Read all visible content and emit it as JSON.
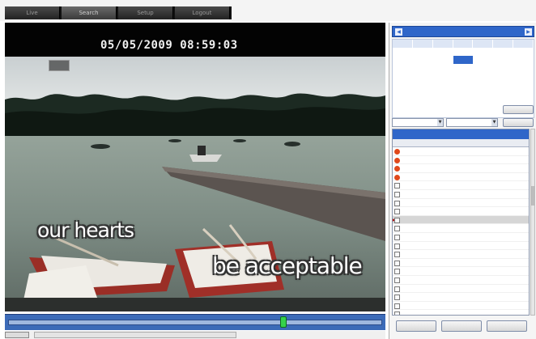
{
  "tabs": [
    "Live",
    "Search",
    "Setup",
    "Logout"
  ],
  "active_tab": 1,
  "video": {
    "timestamp": "05/05/2009 08:59:03",
    "subtitle_line1": "our hearts",
    "subtitle_line2": "be acceptable"
  },
  "timeline": {
    "position": 0.74
  },
  "status": {
    "button": "",
    "text": ""
  },
  "calendar": {
    "title": "",
    "prev_icon": "arrow-left-icon",
    "next_icon": "arrow-right-icon",
    "weekdays": [
      "",
      "",
      "",
      "",
      "",
      "",
      ""
    ],
    "weeks": [
      [
        "",
        "",
        "",
        "",
        "",
        "",
        ""
      ],
      [
        "",
        "",
        "",
        "",
        "",
        "",
        ""
      ],
      [
        "",
        "",
        "",
        "",
        "",
        "",
        ""
      ],
      [
        "",
        "",
        "",
        "",
        "",
        "",
        ""
      ],
      [
        "",
        "",
        "",
        "",
        "",
        "",
        ""
      ],
      [
        "",
        "",
        "",
        "",
        "",
        "",
        ""
      ]
    ],
    "selected": [
      1,
      3
    ]
  },
  "search_button": "",
  "refresh_button": "",
  "select1": "",
  "select2": "",
  "list": {
    "title": "",
    "headers": [
      "",
      "",
      ""
    ],
    "rows": [
      {
        "icon": "alarm",
        "c1": "",
        "c2": "",
        "c3": ""
      },
      {
        "icon": "alarm",
        "c1": "",
        "c2": "",
        "c3": ""
      },
      {
        "icon": "alarm",
        "c1": "",
        "c2": "",
        "c3": ""
      },
      {
        "icon": "alarm",
        "c1": "",
        "c2": "",
        "c3": ""
      },
      {
        "icon": "file",
        "c1": "",
        "c2": "",
        "c3": ""
      },
      {
        "icon": "file",
        "c1": "",
        "c2": "",
        "c3": ""
      },
      {
        "icon": "file",
        "c1": "",
        "c2": "",
        "c3": ""
      },
      {
        "icon": "file",
        "c1": "",
        "c2": "",
        "c3": ""
      },
      {
        "icon": "file",
        "c1": "",
        "c2": "",
        "c3": "",
        "selected": true
      },
      {
        "icon": "file",
        "c1": "",
        "c2": "",
        "c3": ""
      },
      {
        "icon": "file",
        "c1": "",
        "c2": "",
        "c3": ""
      },
      {
        "icon": "file",
        "c1": "",
        "c2": "",
        "c3": ""
      },
      {
        "icon": "file",
        "c1": "",
        "c2": "",
        "c3": ""
      },
      {
        "icon": "file",
        "c1": "",
        "c2": "",
        "c3": ""
      },
      {
        "icon": "file",
        "c1": "",
        "c2": "",
        "c3": ""
      },
      {
        "icon": "file",
        "c1": "",
        "c2": "",
        "c3": ""
      },
      {
        "icon": "file",
        "c1": "",
        "c2": "",
        "c3": ""
      },
      {
        "icon": "file",
        "c1": "",
        "c2": "",
        "c3": ""
      },
      {
        "icon": "file",
        "c1": "",
        "c2": "",
        "c3": ""
      },
      {
        "icon": "file",
        "c1": "",
        "c2": "",
        "c3": ""
      }
    ]
  },
  "bottom_buttons": [
    "",
    "",
    ""
  ],
  "colors": {
    "accent": "#2f66c9",
    "calendar_title": "#ffcc00",
    "timeline_bar": "#3c6bb8",
    "timeline_knob": "#36d24b",
    "alarm": "#e0481b"
  }
}
